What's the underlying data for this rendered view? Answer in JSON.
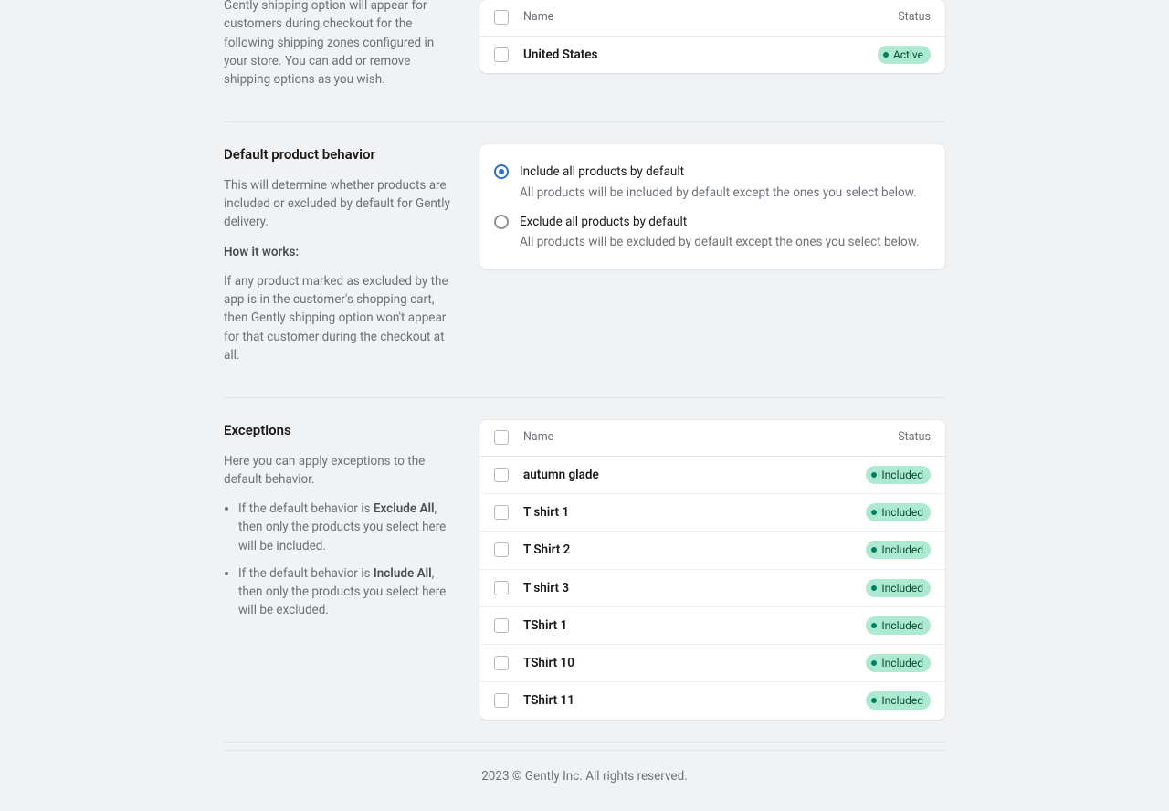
{
  "zones": {
    "description_partial": "Gently shipping option will appear for customers during checkout for the following shipping zones configured in your store. You can add or remove shipping options as you wish.",
    "tbl_name": "Name",
    "tbl_status": "Status",
    "rows": [
      {
        "name": "United States",
        "status": "Active"
      }
    ]
  },
  "behavior": {
    "title": "Default product behavior",
    "description": "This will determine whether products are included or excluded by default for Gently delivery.",
    "how_label": "How it works:",
    "how_text": "If any product marked as excluded by the app is in the customer's shopping cart, then Gently shipping option won't appear for that customer during the checkout at all.",
    "options": [
      {
        "title": "Include all products by default",
        "desc": "All products will be included by default except the ones you select below.",
        "selected": true
      },
      {
        "title": "Exclude all products by default",
        "desc": "All products will be excluded by default except the ones you select below.",
        "selected": false
      }
    ]
  },
  "exceptions": {
    "title": "Exceptions",
    "description": "Here you can apply exceptions to the default behavior.",
    "bullet1_prefix": "If the default behavior is ",
    "bullet1_strong": "Exclude All",
    "bullet1_suffix": ", then only the products you select here will be included.",
    "bullet2_prefix": "If the default behavior is ",
    "bullet2_strong": "Include All",
    "bullet2_suffix": ", then only the products you select here will be excluded.",
    "tbl_name": "Name",
    "tbl_status": "Status",
    "rows": [
      {
        "name": "autumn glade",
        "status": "Included"
      },
      {
        "name": "T shirt 1",
        "status": "Included"
      },
      {
        "name": "T Shirt 2",
        "status": "Included"
      },
      {
        "name": "T shirt 3",
        "status": "Included"
      },
      {
        "name": "TShirt 1",
        "status": "Included"
      },
      {
        "name": "TShirt 10",
        "status": "Included"
      },
      {
        "name": "TShirt 11",
        "status": "Included"
      }
    ]
  },
  "footer": "2023 © Gently Inc. All rights reserved."
}
